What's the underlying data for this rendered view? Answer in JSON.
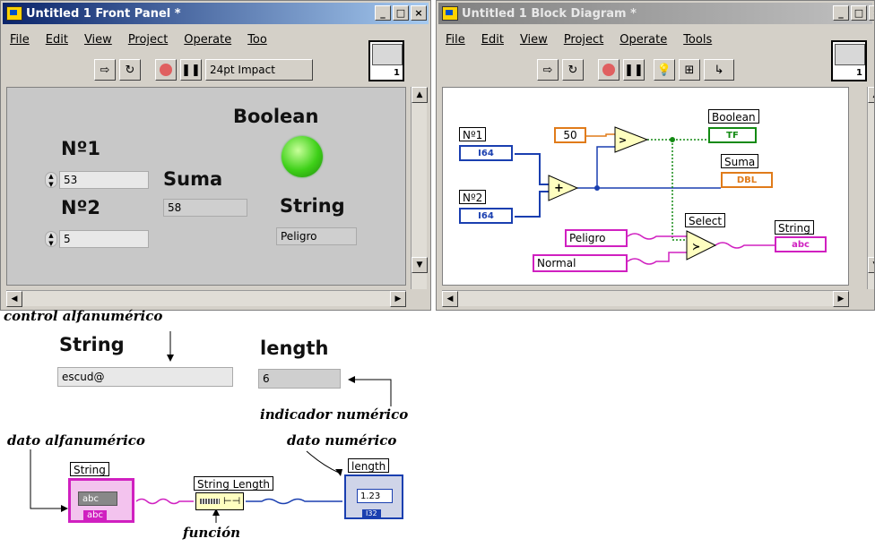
{
  "front_panel": {
    "title": "Untitled 1 Front Panel *",
    "menu": [
      "File",
      "Edit",
      "View",
      "Project",
      "Operate",
      "Too"
    ],
    "font_selector": "24pt Impact",
    "icon_number": "1",
    "controls": {
      "n1_label": "Nº1",
      "n1_value": "53",
      "n2_label": "Nº2",
      "n2_value": "5",
      "suma_label": "Suma",
      "suma_value": "58",
      "boolean_label": "Boolean",
      "string_label": "String",
      "string_value": "Peligro"
    },
    "window_buttons": [
      "_",
      "□",
      "×"
    ]
  },
  "block_diagram": {
    "title": "Untitled 1 Block Diagram *",
    "menu": [
      "File",
      "Edit",
      "View",
      "Project",
      "Operate",
      "Tools"
    ],
    "icon_number": "1",
    "nodes": {
      "n1": "Nº1",
      "n1_type": "I64",
      "n2": "Nº2",
      "n2_type": "I64",
      "const50": "50",
      "boolean": "Boolean",
      "boolean_type": "TF",
      "suma": "Suma",
      "suma_type": "DBL",
      "select": "Select",
      "peligro": "Peligro",
      "normal": "Normal",
      "string": "String",
      "string_type": "abc"
    }
  },
  "tutorial": {
    "note_control": "control alfanumérico",
    "string_label": "String",
    "string_value": "escud@",
    "length_label": "length",
    "length_value": "6",
    "note_indicator": "indicador numérico",
    "note_dato_alfa": "dato alfanumérico",
    "note_dato_num": "dato numérico",
    "node_string": "String",
    "node_string_inner": "abc",
    "node_string_type": "abc",
    "node_strlen": "String Length",
    "node_length": "length",
    "node_length_inner": "1.23",
    "node_length_type": "I32",
    "note_funcion": "función"
  },
  "colors": {
    "int_wire": "#1a3fb0",
    "dbl_wire": "#e07b1a",
    "bool_wire": "#138a13",
    "string_wire": "#d020c0",
    "led_on": "#3ed018"
  }
}
